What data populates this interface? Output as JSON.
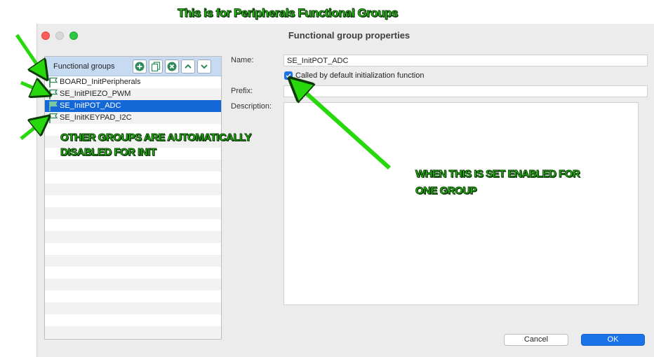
{
  "dialog": {
    "title": "Functional group properties",
    "window_controls": [
      "close-icon",
      "minimize-icon",
      "zoom-icon"
    ]
  },
  "groups_panel": {
    "header": "Functional groups",
    "toolbar_icons": [
      "add-icon",
      "copy-icon",
      "remove-icon",
      "move-up-icon",
      "move-down-icon"
    ],
    "items": [
      {
        "label": "BOARD_InitPeripherals",
        "selected": false
      },
      {
        "label": "SE_InitPIEZO_PWM",
        "selected": false
      },
      {
        "label": "SE_InitPOT_ADC",
        "selected": true
      },
      {
        "label": "SE_InitKEYPAD_I2C",
        "selected": false
      }
    ]
  },
  "form": {
    "name_label": "Name:",
    "name_value": "SE_InitPOT_ADC",
    "default_init_label": "Called by default initialization function",
    "default_init_checked": true,
    "prefix_label": "Prefix:",
    "prefix_value": "",
    "description_label": "Description:",
    "description_value": ""
  },
  "buttons": {
    "cancel": "Cancel",
    "ok": "OK"
  },
  "annotations": {
    "top": "This is for Peripherals Functional Groups",
    "left_line1": "OTHER GROUPS ARE AUTOMATICALLY",
    "left_line2": "DISABLED FOR INIT",
    "right_line1": "WHEN THIS IS SET ENABLED FOR",
    "right_line2": "ONE GROUP",
    "color": "#27d80d"
  },
  "colors": {
    "selection": "#1467d6",
    "accent": "#1a73e8",
    "flag": "#2d8a5b"
  }
}
